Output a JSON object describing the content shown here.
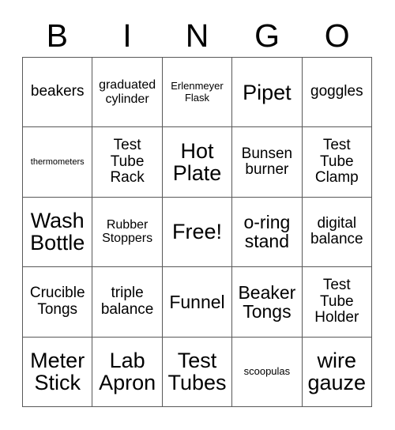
{
  "card": {
    "title": "BINGO",
    "header_letters": [
      "B",
      "I",
      "N",
      "G",
      "O"
    ],
    "free_space_label": "Free!",
    "border_color": "#595959",
    "background_color": "#ffffff",
    "text_color": "#000000",
    "rows": 5,
    "columns": 5,
    "cells": [
      {
        "text": "beakers",
        "size": "m",
        "marked": false
      },
      {
        "text": "graduated cylinder",
        "size": "s",
        "marked": false
      },
      {
        "text": "Erlenmeyer Flask",
        "size": "xs",
        "marked": false
      },
      {
        "text": "Pipet",
        "size": "xl",
        "marked": false
      },
      {
        "text": "goggles",
        "size": "m",
        "marked": false
      },
      {
        "text": "thermometers",
        "size": "xxs",
        "marked": false
      },
      {
        "text": "Test Tube Rack",
        "size": "m",
        "marked": false
      },
      {
        "text": "Hot Plate",
        "size": "xl",
        "marked": false
      },
      {
        "text": "Bunsen burner",
        "size": "m",
        "marked": false
      },
      {
        "text": "Test Tube Clamp",
        "size": "m",
        "marked": false
      },
      {
        "text": "Wash Bottle",
        "size": "xl",
        "marked": false
      },
      {
        "text": "Rubber Stoppers",
        "size": "s",
        "marked": false
      },
      {
        "text": "Free!",
        "size": "xl",
        "marked": false
      },
      {
        "text": "o-ring stand",
        "size": "l",
        "marked": false
      },
      {
        "text": "digital balance",
        "size": "m",
        "marked": false
      },
      {
        "text": "Crucible Tongs",
        "size": "m",
        "marked": false
      },
      {
        "text": "triple balance",
        "size": "m",
        "marked": false
      },
      {
        "text": "Funnel",
        "size": "l",
        "marked": false
      },
      {
        "text": "Beaker Tongs",
        "size": "l",
        "marked": false
      },
      {
        "text": "Test Tube Holder",
        "size": "m",
        "marked": false
      },
      {
        "text": "Meter Stick",
        "size": "xl",
        "marked": false
      },
      {
        "text": "Lab Apron",
        "size": "xl",
        "marked": false
      },
      {
        "text": "Test Tubes",
        "size": "xl",
        "marked": false
      },
      {
        "text": "scoopulas",
        "size": "xs",
        "marked": false
      },
      {
        "text": "wire gauze",
        "size": "xl",
        "marked": false
      }
    ]
  }
}
